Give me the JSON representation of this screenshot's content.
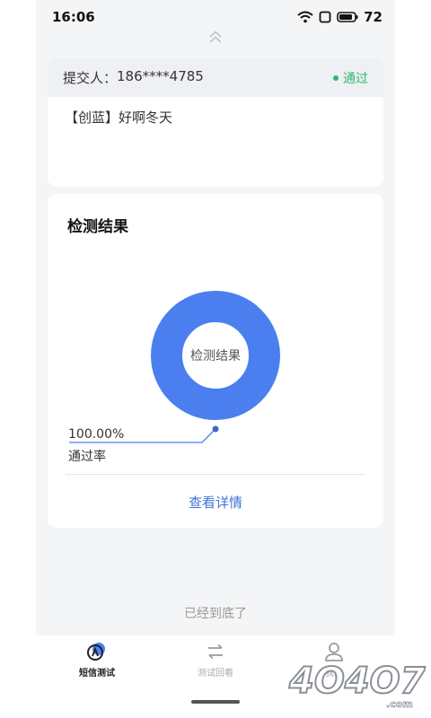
{
  "status_bar": {
    "time": "16:06",
    "battery": "72"
  },
  "submission": {
    "submitter_label": "提交人：",
    "submitter_phone": "186****4785",
    "status": "通过",
    "message": "【创蓝】好啊冬天"
  },
  "result": {
    "title": "检测结果",
    "donut_center": "检测结果",
    "pass_rate_value": "100.00%",
    "pass_rate_label": "通过率",
    "detail_link": "查看详情"
  },
  "chart_data": {
    "type": "pie",
    "categories": [
      "通过"
    ],
    "values": [
      100.0
    ],
    "colors": [
      "#4b7ff0"
    ],
    "title": "检测结果"
  },
  "footer_note": "已经到底了",
  "tabs": [
    {
      "label": "短信测试",
      "active": true
    },
    {
      "label": "测试回看",
      "active": false
    },
    {
      "label": "我的",
      "active": false
    }
  ],
  "colors": {
    "accent": "#4b7ff0",
    "link": "#3e74d6",
    "success": "#2fb86a"
  },
  "watermark": "4O4O7.com"
}
